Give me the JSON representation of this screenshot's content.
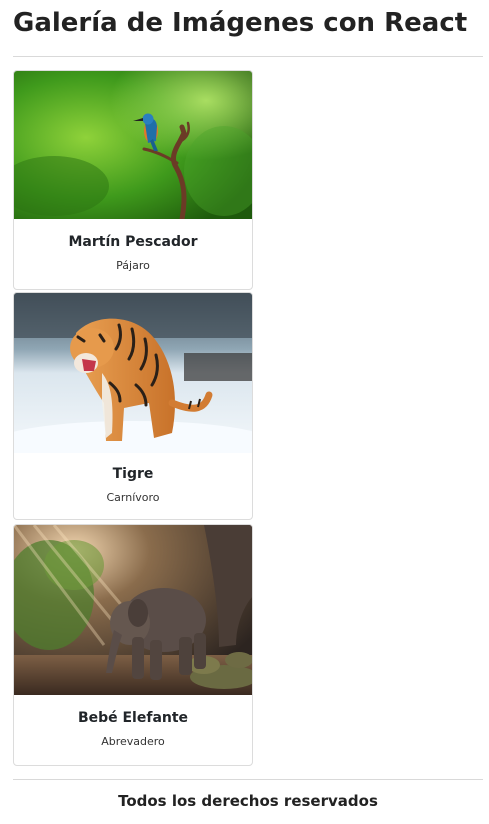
{
  "header": {
    "title": "Galería de Imágenes con React"
  },
  "gallery": {
    "cards": [
      {
        "title": "Martín Pescador",
        "subtitle": "Pájaro",
        "image": "kingfisher-photo"
      },
      {
        "title": "Tigre",
        "subtitle": "Carnívoro",
        "image": "tiger-photo"
      },
      {
        "title": "Bebé Elefante",
        "subtitle": "Abrevadero",
        "image": "baby-elephant-photo"
      }
    ]
  },
  "footer": {
    "text": "Todos los derechos reservados"
  }
}
